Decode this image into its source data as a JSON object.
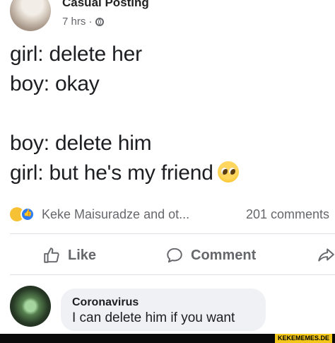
{
  "post": {
    "author": "Casual Posting",
    "time": "7 hrs ·",
    "privacy_icon": "globe-icon",
    "lines": [
      "girl: delete her",
      "boy: okay",
      "boy: delete him",
      "girl: but he's my friend"
    ],
    "emoji": "pleading-face"
  },
  "reactions": {
    "icons": [
      "haha-icon",
      "like-icon"
    ],
    "reactors": "Keke Maisuradze and ot...",
    "comments_count": "201 comments"
  },
  "actions": {
    "like": "Like",
    "comment": "Comment"
  },
  "comment": {
    "author": "Coronavirus",
    "text": "I can delete him if you want"
  },
  "watermark": "KEKEMEMES.DE",
  "colors": {
    "meta_text": "#65676b",
    "bubble": "#eff1f4",
    "watermark_bg": "#f3c61a"
  }
}
